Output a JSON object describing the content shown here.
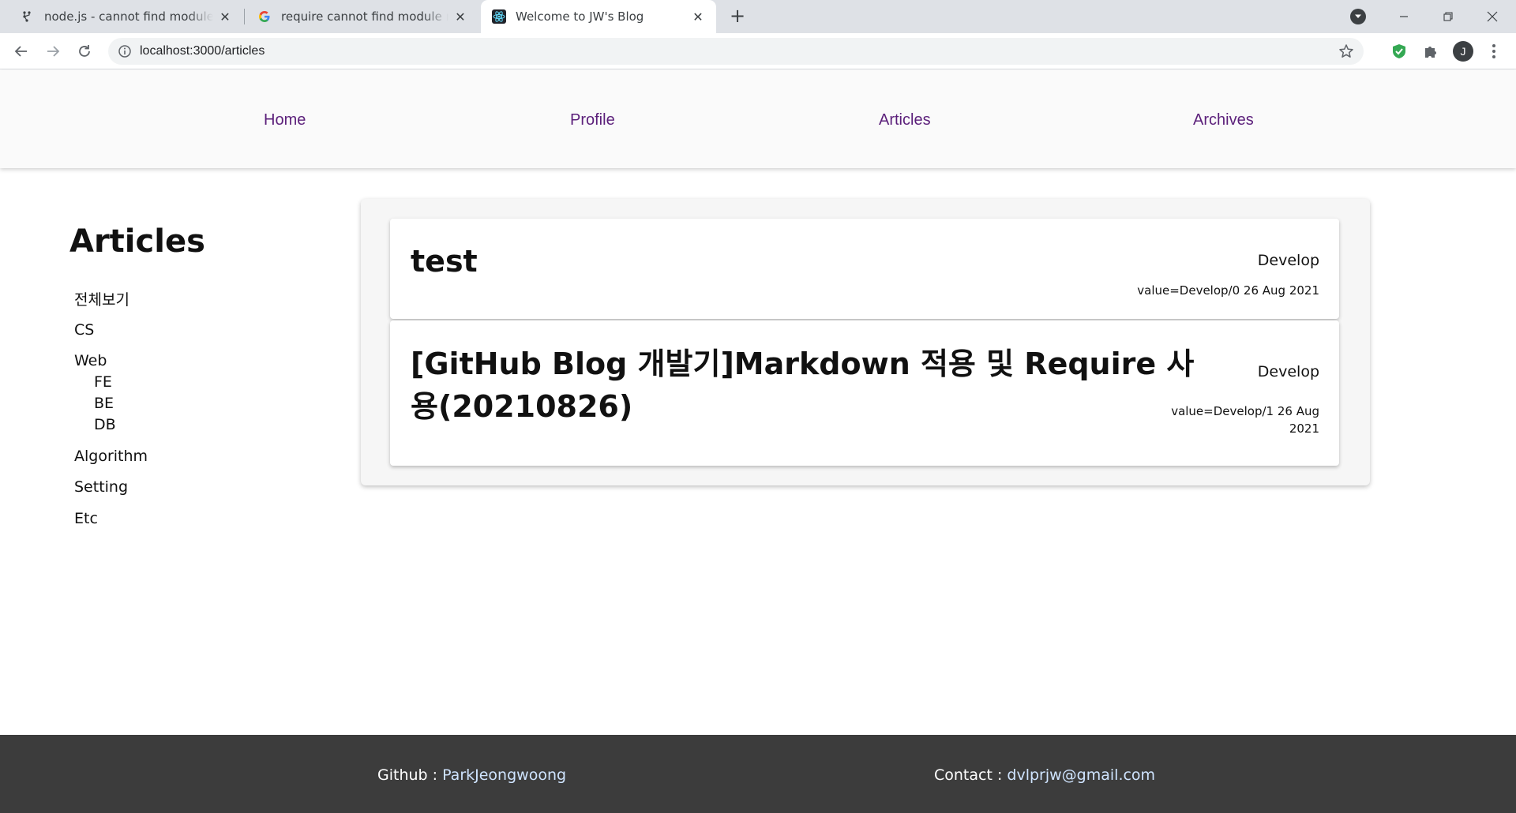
{
  "browser": {
    "tabs": [
      {
        "title": "node.js - cannot find module 'routes'",
        "icon": "github-icon",
        "active": false
      },
      {
        "title": "require cannot find module routes",
        "icon": "google-icon",
        "active": false
      },
      {
        "title": "Welcome to JW's Blog",
        "icon": "react-icon",
        "active": true
      }
    ],
    "url": "localhost:3000/articles",
    "profile_initial": "J"
  },
  "nav": {
    "home": "Home",
    "profile": "Profile",
    "articles": "Articles",
    "archives": "Archives"
  },
  "sidebar": {
    "title": "Articles",
    "items": [
      {
        "label": "전체보기"
      },
      {
        "label": "CS"
      },
      {
        "label": "Web",
        "children": [
          "FE",
          "BE",
          "DB"
        ]
      },
      {
        "label": "Algorithm"
      },
      {
        "label": "Setting"
      },
      {
        "label": "Etc"
      }
    ]
  },
  "articles": [
    {
      "title": "test",
      "category": "Develop",
      "meta": "value=Develop/0 26 Aug 2021"
    },
    {
      "title_line1": "[GitHub Blog 개발기]Markdown 적용 및 Require 사",
      "title_line2": "용(20210826)",
      "category": "Develop",
      "meta_line1": "value=Develop/1 26 Aug",
      "meta_line2": "2021"
    }
  ],
  "footer": {
    "github_label": "Github : ",
    "github_link": "ParkJeongwoong",
    "contact_label": "Contact : ",
    "contact_link": "dvlprjw@gmail.com"
  },
  "colors": {
    "nav_link": "#5b1f7a",
    "footer_bg": "#3c3c3c",
    "footer_link": "#cfe4ff",
    "tabstrip_bg": "#dee1e6"
  }
}
